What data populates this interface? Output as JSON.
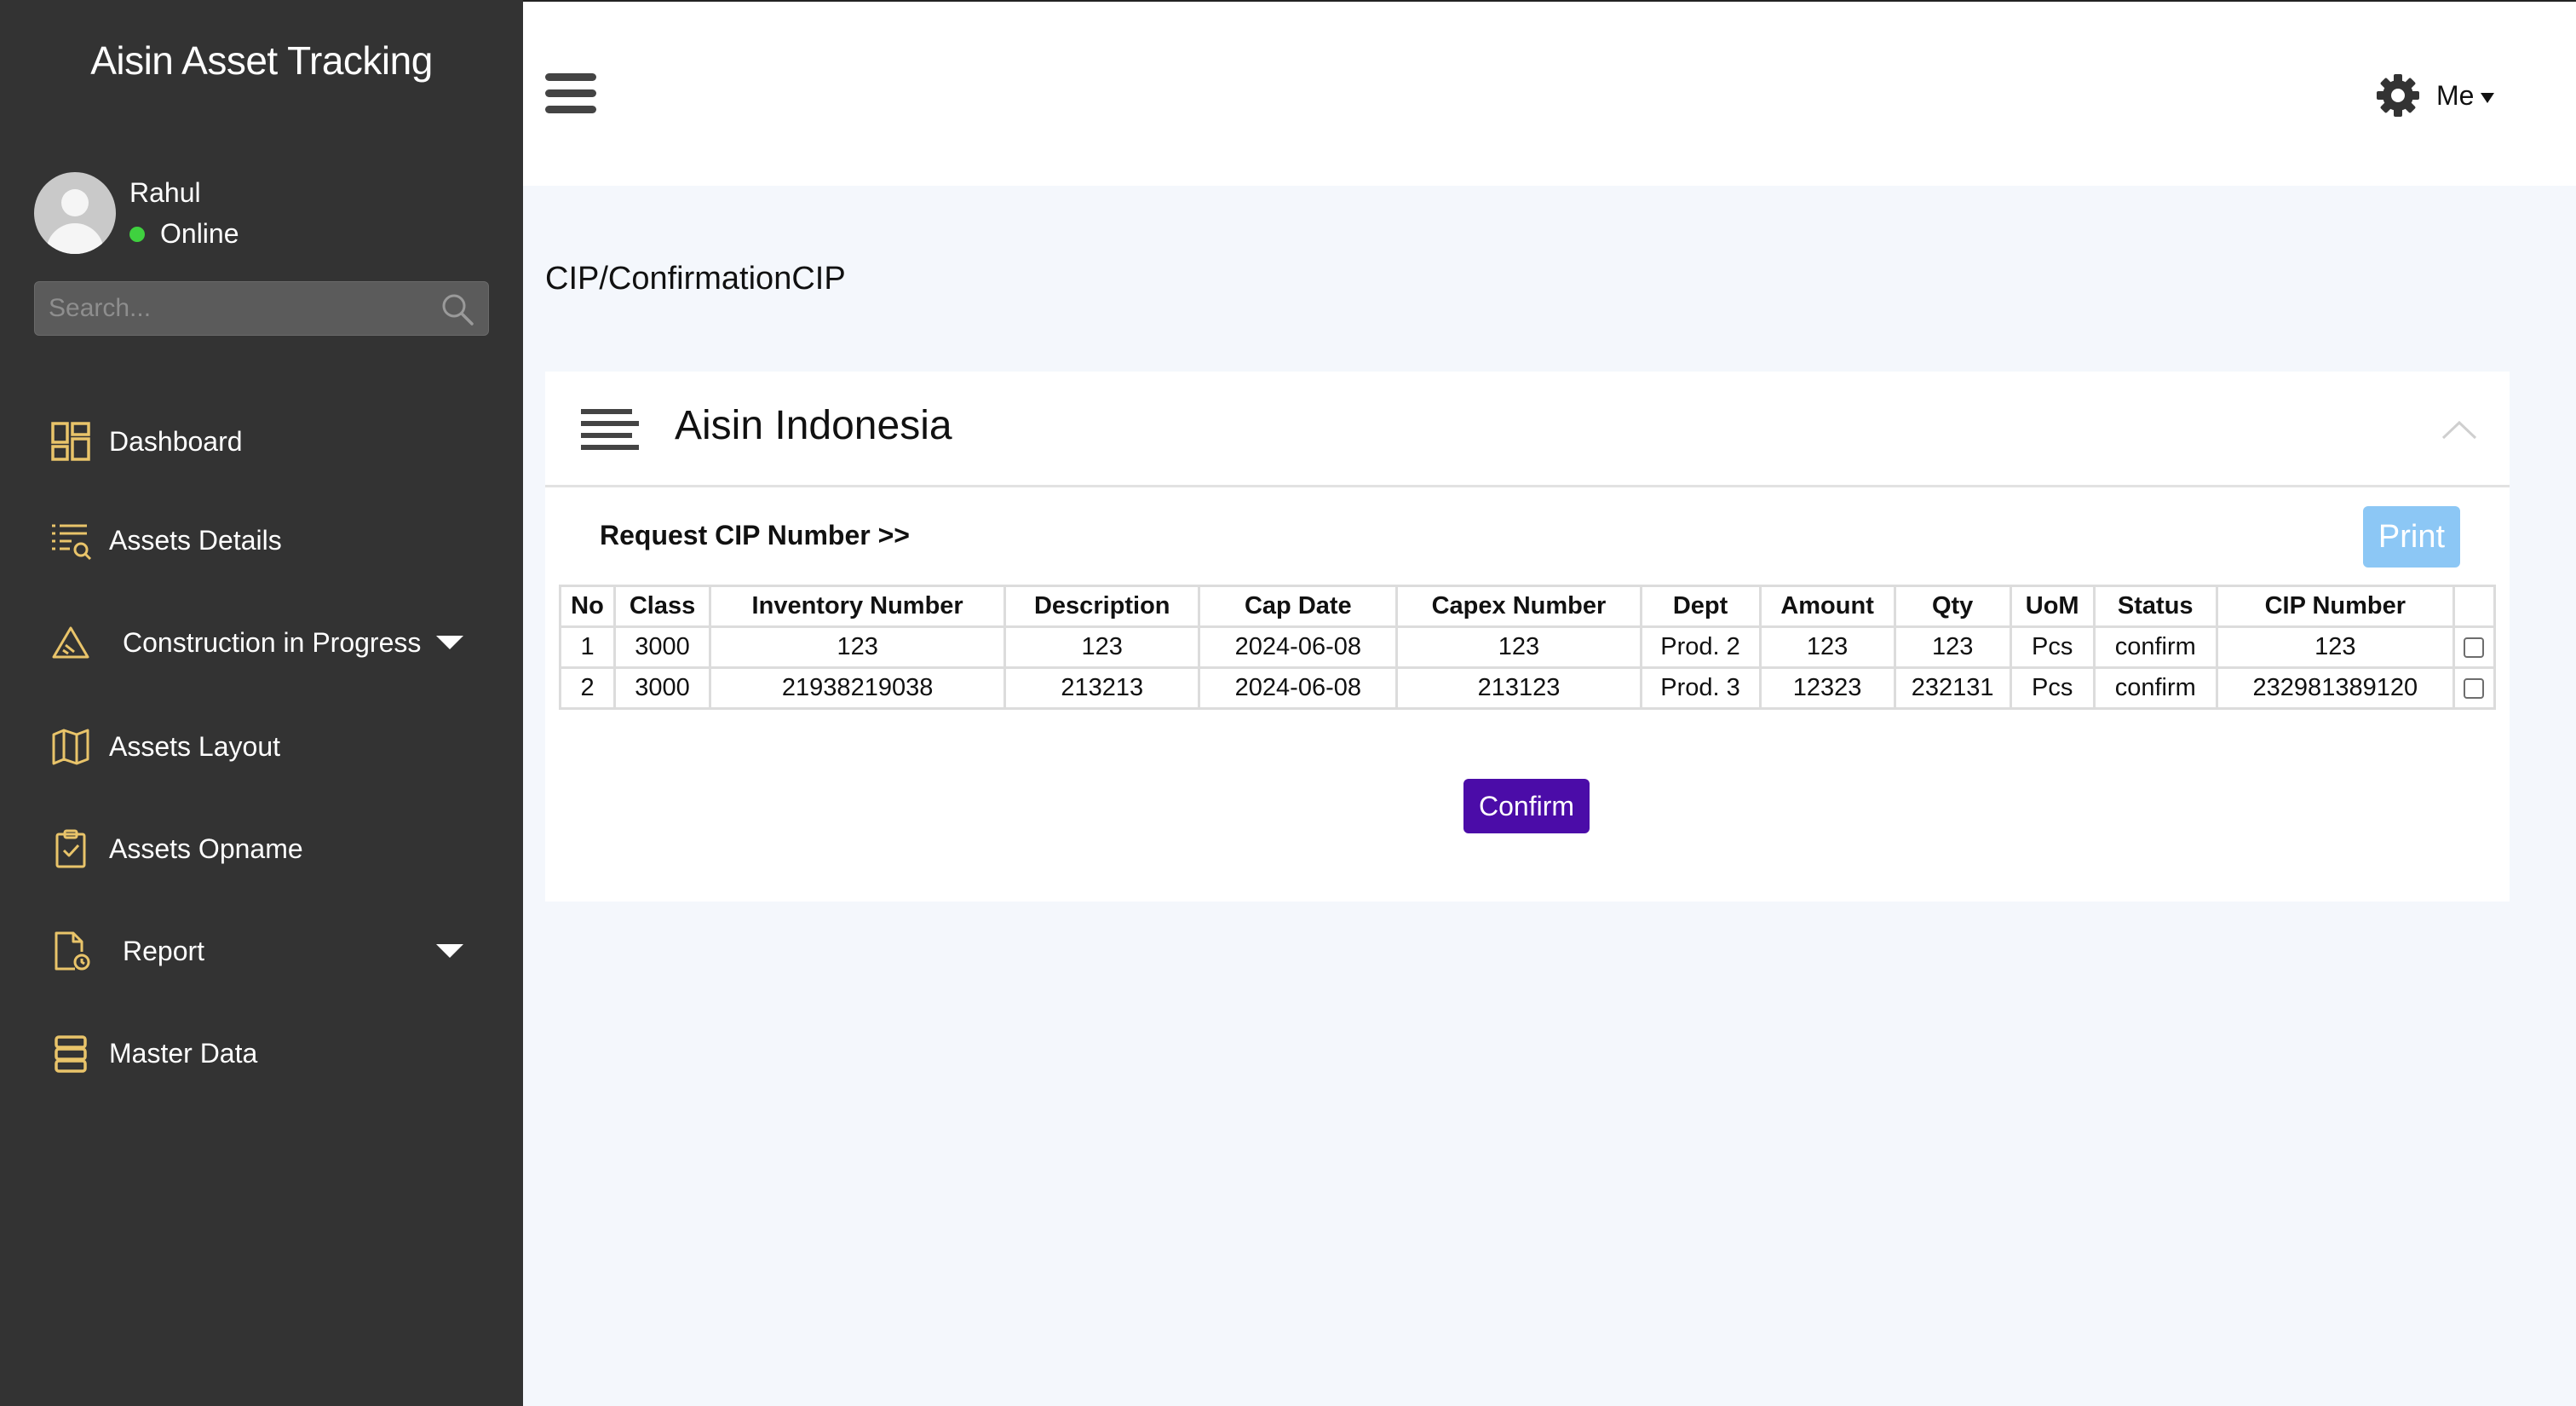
{
  "app": {
    "title": "Aisin Asset Tracking"
  },
  "user": {
    "name": "Rahul",
    "status": "Online"
  },
  "search": {
    "placeholder": "Search..."
  },
  "nav": {
    "items": [
      {
        "label": "Dashboard",
        "icon": "dashboard-icon"
      },
      {
        "label": "Assets Details",
        "icon": "list-search-icon"
      },
      {
        "label": "Construction in Progress",
        "icon": "warning-icon",
        "expandable": true
      },
      {
        "label": "Assets Layout",
        "icon": "map-icon"
      },
      {
        "label": "Assets Opname",
        "icon": "clipboard-check-icon"
      },
      {
        "label": "Report",
        "icon": "report-file-icon",
        "expandable": true
      },
      {
        "label": "Master Data",
        "icon": "database-icon"
      }
    ]
  },
  "topbar": {
    "account_label": "Me"
  },
  "page": {
    "breadcrumb": "CIP/ConfirmationCIP"
  },
  "card": {
    "title": "Aisin Indonesia",
    "request_label": "Request CIP Number >>",
    "print_label": "Print",
    "confirm_label": "Confirm"
  },
  "table": {
    "columns": [
      "No",
      "Class",
      "Inventory Number",
      "Description",
      "Cap Date",
      "Capex Number",
      "Dept",
      "Amount",
      "Qty",
      "UoM",
      "Status",
      "CIP Number",
      ""
    ],
    "rows": [
      [
        "1",
        "3000",
        "123",
        "123",
        "2024-06-08",
        "123",
        "Prod. 2",
        "123",
        "123",
        "Pcs",
        "confirm",
        "123"
      ],
      [
        "2",
        "3000",
        "21938219038",
        "213213",
        "2024-06-08",
        "213123",
        "Prod. 3",
        "12323",
        "232131",
        "Pcs",
        "confirm",
        "232981389120"
      ]
    ],
    "checked": [
      false,
      false
    ]
  },
  "colors": {
    "sidebar_bg": "#333333",
    "icon_accent": "#e9c46a",
    "online": "#3fd13f",
    "confirm_button": "#4b0ca8",
    "print_button": "#8cc7f5",
    "page_bg": "#f4f7fc"
  }
}
